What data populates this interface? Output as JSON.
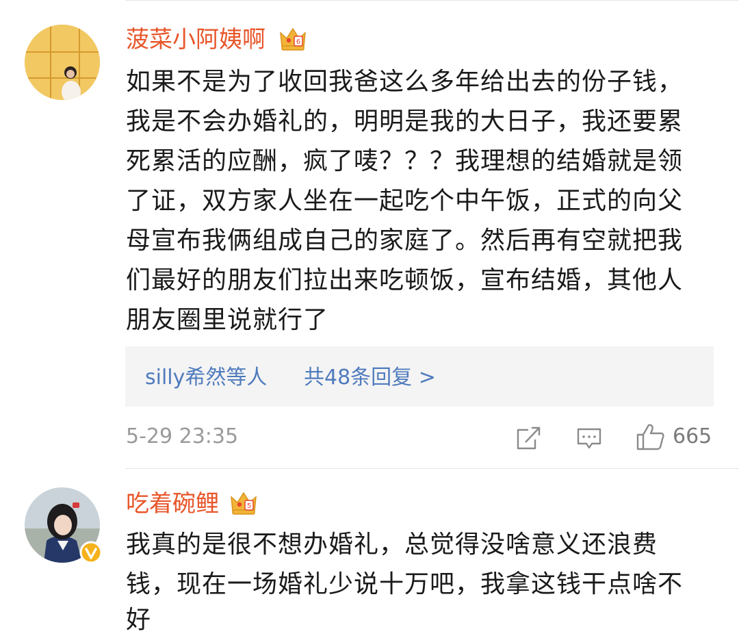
{
  "comments": [
    {
      "username": "菠菜小阿姨啊",
      "badge_icon": "crown-icon",
      "lines": [
        "如果不是为了收回我爸这么多年给出去的份子钱，",
        "我是不会办婚礼的，明明是我的大日子，我还要累",
        "死累活的应酬，疯了唛？？？我理想的结婚就是领",
        "了证，双方家人坐在一起吃个中午饭，正式的向父",
        "母宣布我俩组成自己的家庭了。然后再有空就把我",
        "们最好的朋友们拉出来吃顿饭，宣布结婚，其他人",
        "朋友圈里说就行了"
      ],
      "replies": {
        "who": "silly希然等人",
        "count_label": "共48条回复 >"
      },
      "timestamp": "5-29 23:35",
      "like_count": "665"
    },
    {
      "username": "吃着碗鲤",
      "badge_icon": "crown-icon",
      "verified_icon": "verified-v-icon",
      "lines": [
        "我真的是很不想办婚礼，总觉得没啥意义还浪费",
        "钱，现在一场婚礼少说十万吧，我拿这钱干点啥不",
        "好"
      ]
    }
  ],
  "colors": {
    "username": "#e8562a",
    "reply_link": "#4f7bbd",
    "crown": "#f2b437",
    "verified": "#f5b21b"
  }
}
